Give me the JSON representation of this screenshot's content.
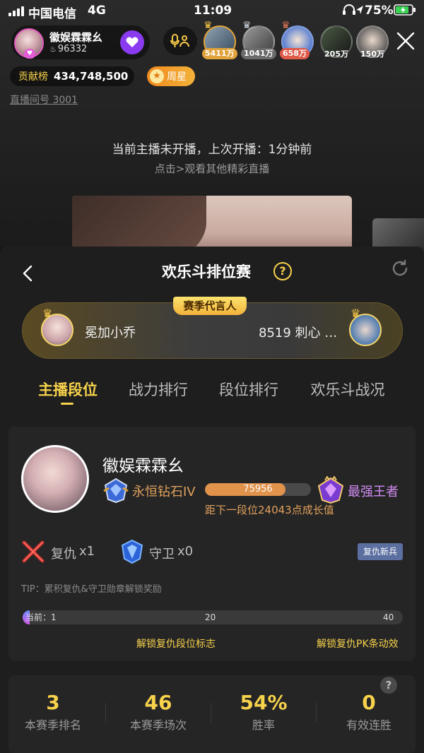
{
  "status_bar": {
    "carrier": "中国电信",
    "network": "4G",
    "time": "11:09",
    "battery": "75%"
  },
  "live_header": {
    "host_name": "徽娱霖霖幺",
    "host_heat": "96332",
    "contribution_label": "贡献榜",
    "contribution_value": "434,748,500",
    "week_star_label": "周星",
    "room_no": "直播间号 3001",
    "viewers": [
      {
        "value": "5411万",
        "color": "#e0a23a"
      },
      {
        "value": "1041万",
        "color": "#6b6b6b"
      },
      {
        "value": "658万",
        "color": "#e05a4a"
      },
      {
        "value": "205万",
        "color": ""
      },
      {
        "value": "150万",
        "color": ""
      }
    ]
  },
  "offline_notice": {
    "line1": "当前主播未开播，上次开播：1分钟前",
    "line2": "点击>观看其他精彩直播"
  },
  "panel": {
    "title": "欢乐斗排位赛",
    "spokesperson_tag": "赛季代言人",
    "spokesperson_left_name": "冕加小乔",
    "spokesperson_right_name": "8519 刺心 …",
    "tabs": [
      {
        "label": "主播段位",
        "active": true
      },
      {
        "label": "战力排行",
        "active": false
      },
      {
        "label": "段位排行",
        "active": false
      },
      {
        "label": "欢乐斗战况",
        "active": false
      }
    ],
    "anchor": {
      "name": "徽娱霖霖幺",
      "current_tier": "永恒钻石IV",
      "next_tier": "最强王者",
      "points": "75956",
      "progress_fraction": 0.76,
      "next_tier_hint": "距下一段位24043点成长值"
    },
    "medals": {
      "revenge_label": "复仇",
      "revenge_count": "x1",
      "guard_label": "守卫",
      "guard_count": "x0",
      "badge_label": "复仇新兵"
    },
    "tip": "TIP：累积复仇&守卫勋章解锁奖励",
    "unlock_track": {
      "current_label": "当前：1",
      "mid_label": "20",
      "end_label": "40",
      "reward_left": "解锁复仇段位标志",
      "reward_right": "解锁复仇PK条动效"
    },
    "stats": [
      {
        "value": "3",
        "label": "本赛季排名"
      },
      {
        "value": "46",
        "label": "本赛季场次"
      },
      {
        "value": "54%",
        "label": "胜率"
      },
      {
        "value": "0",
        "label": "有效连胜"
      }
    ],
    "help_symbol": "?"
  }
}
